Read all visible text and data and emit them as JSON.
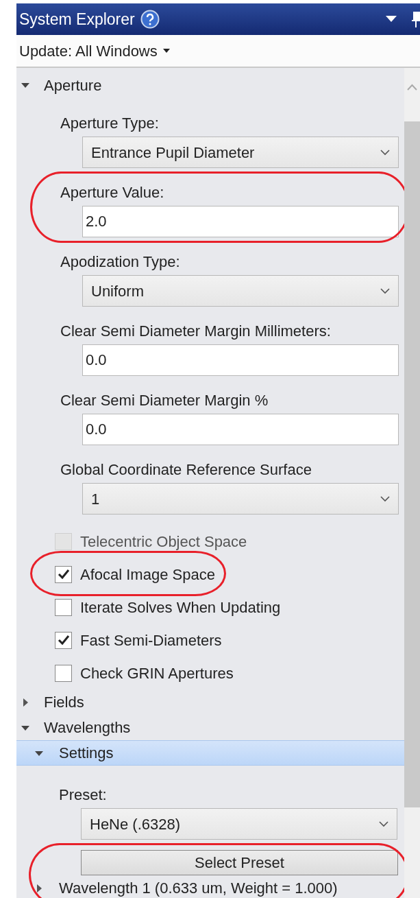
{
  "window": {
    "title": "System Explorer"
  },
  "update_menu": {
    "label": "Update: All Windows"
  },
  "tree": [
    {
      "label": "Aperture",
      "expanded": true,
      "selected": false,
      "children": [
        {
          "kind": "select",
          "label": "Aperture Type:",
          "value": "Entrance Pupil Diameter"
        },
        {
          "kind": "input",
          "label": "Aperture Value:",
          "value": "2.0",
          "highlighted": true
        },
        {
          "kind": "select",
          "label": "Apodization Type:",
          "value": "Uniform"
        },
        {
          "kind": "input",
          "label": "Clear Semi Diameter Margin Millimeters:",
          "value": "0.0"
        },
        {
          "kind": "input",
          "label": "Clear Semi Diameter Margin %",
          "value": "0.0"
        },
        {
          "kind": "select",
          "label": "Global Coordinate Reference Surface",
          "value": "1"
        },
        {
          "kind": "checkbox",
          "label": "Telecentric Object Space",
          "checked": false,
          "disabled": true
        },
        {
          "kind": "checkbox",
          "label": "Afocal Image Space",
          "checked": true,
          "disabled": false,
          "highlighted": true
        },
        {
          "kind": "checkbox",
          "label": "Iterate Solves When Updating",
          "checked": false,
          "disabled": false
        },
        {
          "kind": "checkbox",
          "label": "Fast Semi-Diameters",
          "checked": true,
          "disabled": false
        },
        {
          "kind": "checkbox",
          "label": "Check GRIN Apertures",
          "checked": false,
          "disabled": false
        }
      ]
    },
    {
      "label": "Fields",
      "expanded": false,
      "selected": false
    },
    {
      "label": "Wavelengths",
      "expanded": true,
      "selected": false,
      "children": [
        {
          "kind": "node",
          "label": "Settings",
          "expanded": true,
          "selected": true,
          "children": [
            {
              "kind": "select",
              "label": "Preset:",
              "value": "HeNe (.6328)"
            },
            {
              "kind": "button",
              "label": "Select Preset",
              "highlighted": true
            },
            {
              "kind": "node",
              "label": "Wavelength 1 (0.633 um, Weight = 1.000)",
              "expanded": false,
              "selected": false,
              "highlighted": true
            }
          ]
        }
      ]
    }
  ]
}
